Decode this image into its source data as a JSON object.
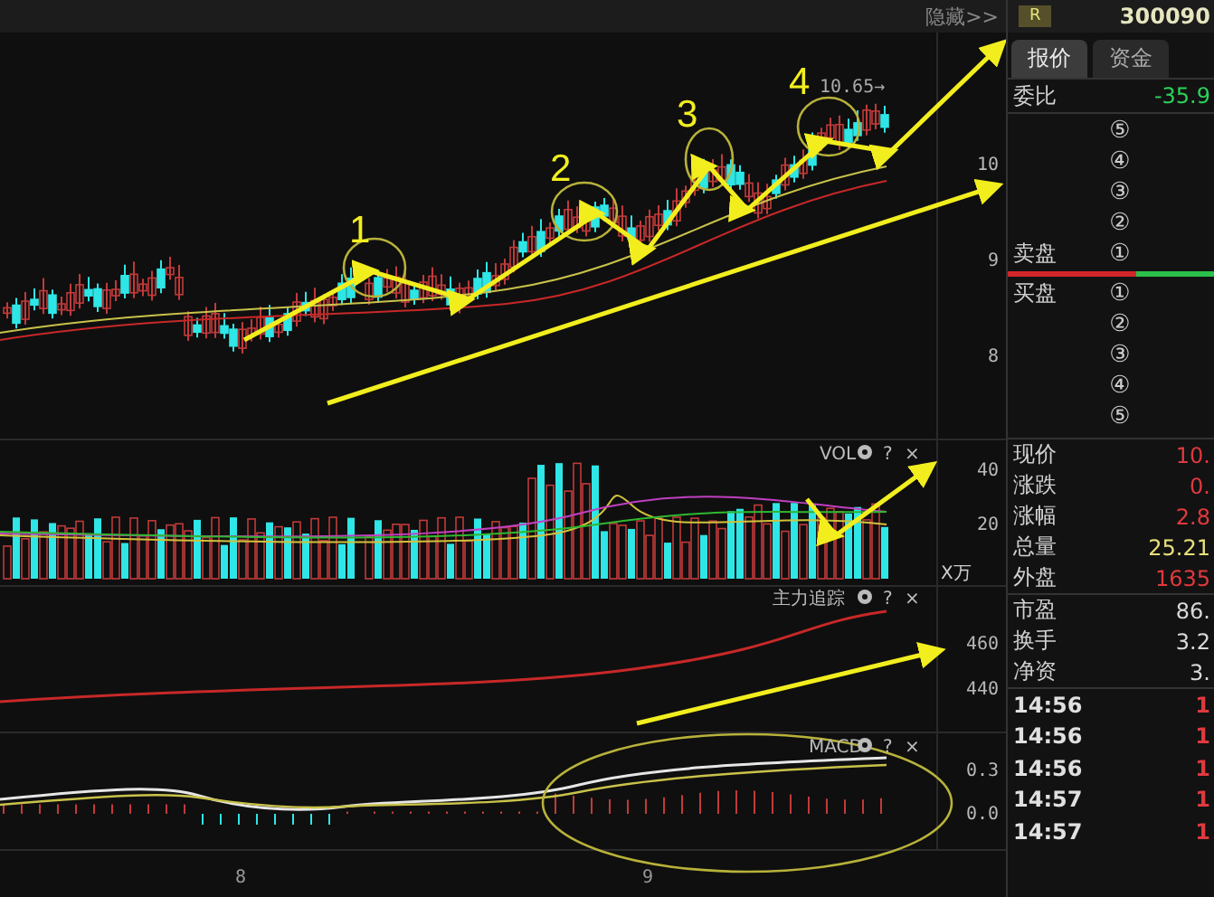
{
  "top_bar": {
    "hide_link": "隐藏>>",
    "badge": "R",
    "code": "300090"
  },
  "price_chart": {
    "wave_labels": [
      "1",
      "2",
      "3",
      "4"
    ],
    "price_tag": "10.65→",
    "axis_labels": [
      "10",
      "9",
      "8"
    ]
  },
  "volume_panel": {
    "title": "VOL",
    "help": "?",
    "close": "×",
    "axis_labels": [
      "40",
      "20"
    ],
    "unit": "X万"
  },
  "main_force_panel": {
    "title": "主力追踪",
    "help": "?",
    "close": "×",
    "axis_labels": [
      "460",
      "440"
    ]
  },
  "macd_panel": {
    "title": "MACD",
    "help": "?",
    "close": "×",
    "axis_labels": [
      "0.3",
      "0.0"
    ]
  },
  "x_axis": [
    "8",
    "9"
  ],
  "quote_panel": {
    "tabs": [
      {
        "label": "报价",
        "selected": true
      },
      {
        "label": "资金",
        "selected": false
      }
    ],
    "ratio": {
      "label": "委比",
      "value": "-35.9"
    },
    "asks": {
      "label": "卖盘",
      "levels": [
        "⑤",
        "④",
        "③",
        "②",
        "①"
      ]
    },
    "bids": {
      "label": "买盘",
      "levels": [
        "①",
        "②",
        "③",
        "④",
        "⑤"
      ]
    },
    "pressure_bar": {
      "level": 0.62
    },
    "stats": [
      {
        "label": "现价",
        "value": "10.",
        "color": "#e0393e"
      },
      {
        "label": "涨跌",
        "value": "0.",
        "color": "#e0393e"
      },
      {
        "label": "涨幅",
        "value": "2.8",
        "color": "#e0393e"
      },
      {
        "label": "总量",
        "value": "25.21",
        "color": "#e8e07a"
      },
      {
        "label": "外盘",
        "value": "1635",
        "color": "#e0393e"
      },
      {
        "label": "市盈",
        "value": "86.",
        "color": "#d8d8d8"
      },
      {
        "label": "换手",
        "value": "3.2",
        "color": "#d8d8d8"
      },
      {
        "label": "净资",
        "value": "3.",
        "color": "#d8d8d8"
      }
    ],
    "trades": [
      {
        "time": "14:56",
        "value": "1"
      },
      {
        "time": "14:56",
        "value": "1"
      },
      {
        "time": "14:56",
        "value": "1"
      },
      {
        "time": "14:57",
        "value": "1"
      },
      {
        "time": "14:57",
        "value": "1"
      }
    ]
  }
}
